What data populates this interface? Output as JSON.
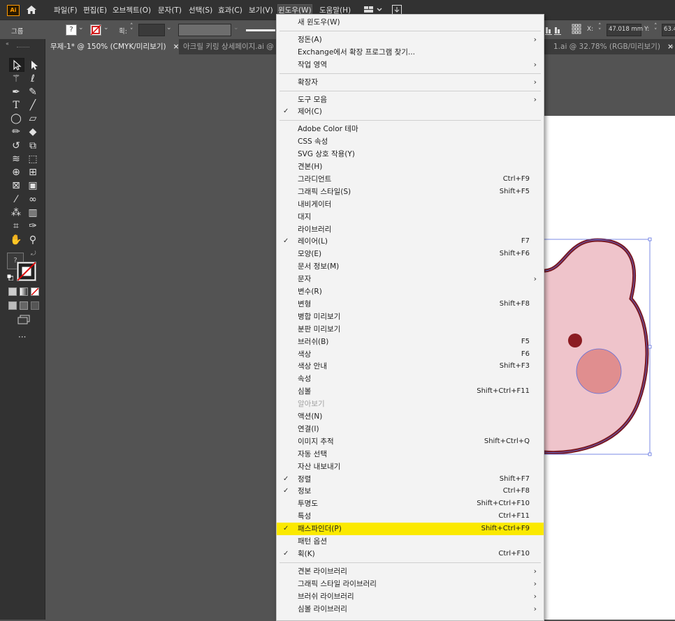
{
  "app": {
    "logo_text": "Ai"
  },
  "menubar": {
    "items": [
      "파일(F)",
      "편집(E)",
      "오브젝트(O)",
      "문자(T)",
      "선택(S)",
      "효과(C)",
      "보기(V)",
      "윈도우(W)",
      "도움말(H)"
    ]
  },
  "controlbar": {
    "selection_label": "그룹",
    "stroke_label": "획:",
    "x_label": "X:",
    "x_value": "47.018 mm",
    "y_label": "Y:",
    "y_value": "63.4"
  },
  "tabs": [
    {
      "label": "무제-1* @ 150% (CMYK/미리보기)",
      "close": "×"
    },
    {
      "label": "아크릴 키링 상세페이지.ai @",
      "close": ""
    },
    {
      "label": "1.ai @ 32.78% (RGB/미리보기)",
      "close": "×"
    },
    {
      "label": "›",
      "close": ""
    }
  ],
  "window_menu": {
    "items": [
      {
        "label": "새 윈도우(W)",
        "shortcut": "",
        "check": false,
        "submenu": false
      },
      {
        "sep": true
      },
      {
        "label": "정돈(A)",
        "shortcut": "",
        "check": false,
        "submenu": true
      },
      {
        "label": "Exchange에서 확장 프로그램 찾기...",
        "shortcut": "",
        "check": false,
        "submenu": false
      },
      {
        "label": "작업 영역",
        "shortcut": "",
        "check": false,
        "submenu": true
      },
      {
        "sep": true
      },
      {
        "label": "확장자",
        "shortcut": "",
        "check": false,
        "submenu": true
      },
      {
        "sep": true
      },
      {
        "label": "도구 모음",
        "shortcut": "",
        "check": false,
        "submenu": true
      },
      {
        "label": "제어(C)",
        "shortcut": "",
        "check": true,
        "submenu": false
      },
      {
        "sep": true
      },
      {
        "label": "Adobe Color 테마",
        "shortcut": "",
        "check": false,
        "submenu": false
      },
      {
        "label": "CSS 속성",
        "shortcut": "",
        "check": false,
        "submenu": false
      },
      {
        "label": "SVG 상호 작용(Y)",
        "shortcut": "",
        "check": false,
        "submenu": false
      },
      {
        "label": "견본(H)",
        "shortcut": "",
        "check": false,
        "submenu": false
      },
      {
        "label": "그라디언트",
        "shortcut": "Ctrl+F9",
        "check": false,
        "submenu": false
      },
      {
        "label": "그래픽 스타일(S)",
        "shortcut": "Shift+F5",
        "check": false,
        "submenu": false
      },
      {
        "label": "내비게이터",
        "shortcut": "",
        "check": false,
        "submenu": false
      },
      {
        "label": "대지",
        "shortcut": "",
        "check": false,
        "submenu": false
      },
      {
        "label": "라이브러리",
        "shortcut": "",
        "check": false,
        "submenu": false
      },
      {
        "label": "레이어(L)",
        "shortcut": "F7",
        "check": true,
        "submenu": false
      },
      {
        "label": "모양(E)",
        "shortcut": "Shift+F6",
        "check": false,
        "submenu": false
      },
      {
        "label": "문서 정보(M)",
        "shortcut": "",
        "check": false,
        "submenu": false
      },
      {
        "label": "문자",
        "shortcut": "",
        "check": false,
        "submenu": true
      },
      {
        "label": "변수(R)",
        "shortcut": "",
        "check": false,
        "submenu": false
      },
      {
        "label": "변형",
        "shortcut": "Shift+F8",
        "check": false,
        "submenu": false
      },
      {
        "label": "병합 미리보기",
        "shortcut": "",
        "check": false,
        "submenu": false
      },
      {
        "label": "분판 미리보기",
        "shortcut": "",
        "check": false,
        "submenu": false
      },
      {
        "label": "브러쉬(B)",
        "shortcut": "F5",
        "check": false,
        "submenu": false
      },
      {
        "label": "색상",
        "shortcut": "F6",
        "check": false,
        "submenu": false
      },
      {
        "label": "색상 안내",
        "shortcut": "Shift+F3",
        "check": false,
        "submenu": false
      },
      {
        "label": "속성",
        "shortcut": "",
        "check": false,
        "submenu": false
      },
      {
        "label": "심볼",
        "shortcut": "Shift+Ctrl+F11",
        "check": false,
        "submenu": false
      },
      {
        "label": "알아보기",
        "shortcut": "",
        "check": false,
        "submenu": false,
        "disabled": true
      },
      {
        "label": "액션(N)",
        "shortcut": "",
        "check": false,
        "submenu": false
      },
      {
        "label": "연결(I)",
        "shortcut": "",
        "check": false,
        "submenu": false
      },
      {
        "label": "이미지 추적",
        "shortcut": "Shift+Ctrl+Q",
        "check": false,
        "submenu": false
      },
      {
        "label": "자동 선택",
        "shortcut": "",
        "check": false,
        "submenu": false
      },
      {
        "label": "자산 내보내기",
        "shortcut": "",
        "check": false,
        "submenu": false
      },
      {
        "label": "정렬",
        "shortcut": "Shift+F7",
        "check": true,
        "submenu": false
      },
      {
        "label": "정보",
        "shortcut": "Ctrl+F8",
        "check": true,
        "submenu": false
      },
      {
        "label": "투명도",
        "shortcut": "Shift+Ctrl+F10",
        "check": false,
        "submenu": false
      },
      {
        "label": "특성",
        "shortcut": "Ctrl+F11",
        "check": false,
        "submenu": false
      },
      {
        "label": "패스파인더(P)",
        "shortcut": "Shift+Ctrl+F9",
        "check": true,
        "submenu": false,
        "highlight": true
      },
      {
        "label": "패턴 옵션",
        "shortcut": "",
        "check": false,
        "submenu": false
      },
      {
        "label": "획(K)",
        "shortcut": "Ctrl+F10",
        "check": true,
        "submenu": false
      },
      {
        "sep": true
      },
      {
        "label": "견본 라이브러리",
        "shortcut": "",
        "check": false,
        "submenu": true
      },
      {
        "label": "그래픽 스타일 라이브러리",
        "shortcut": "",
        "check": false,
        "submenu": true
      },
      {
        "label": "브러쉬 라이브러리",
        "shortcut": "",
        "check": false,
        "submenu": true
      },
      {
        "label": "심볼 라이브러리",
        "shortcut": "",
        "check": false,
        "submenu": true
      }
    ]
  },
  "colors": {
    "highlight": "#fbe900",
    "bear_fill": "#efc4cb",
    "bear_outline": "#7a1a24",
    "cheek": "#e08e8f",
    "eye": "#8b1c22"
  },
  "toolbar": {
    "more_label": "···"
  }
}
